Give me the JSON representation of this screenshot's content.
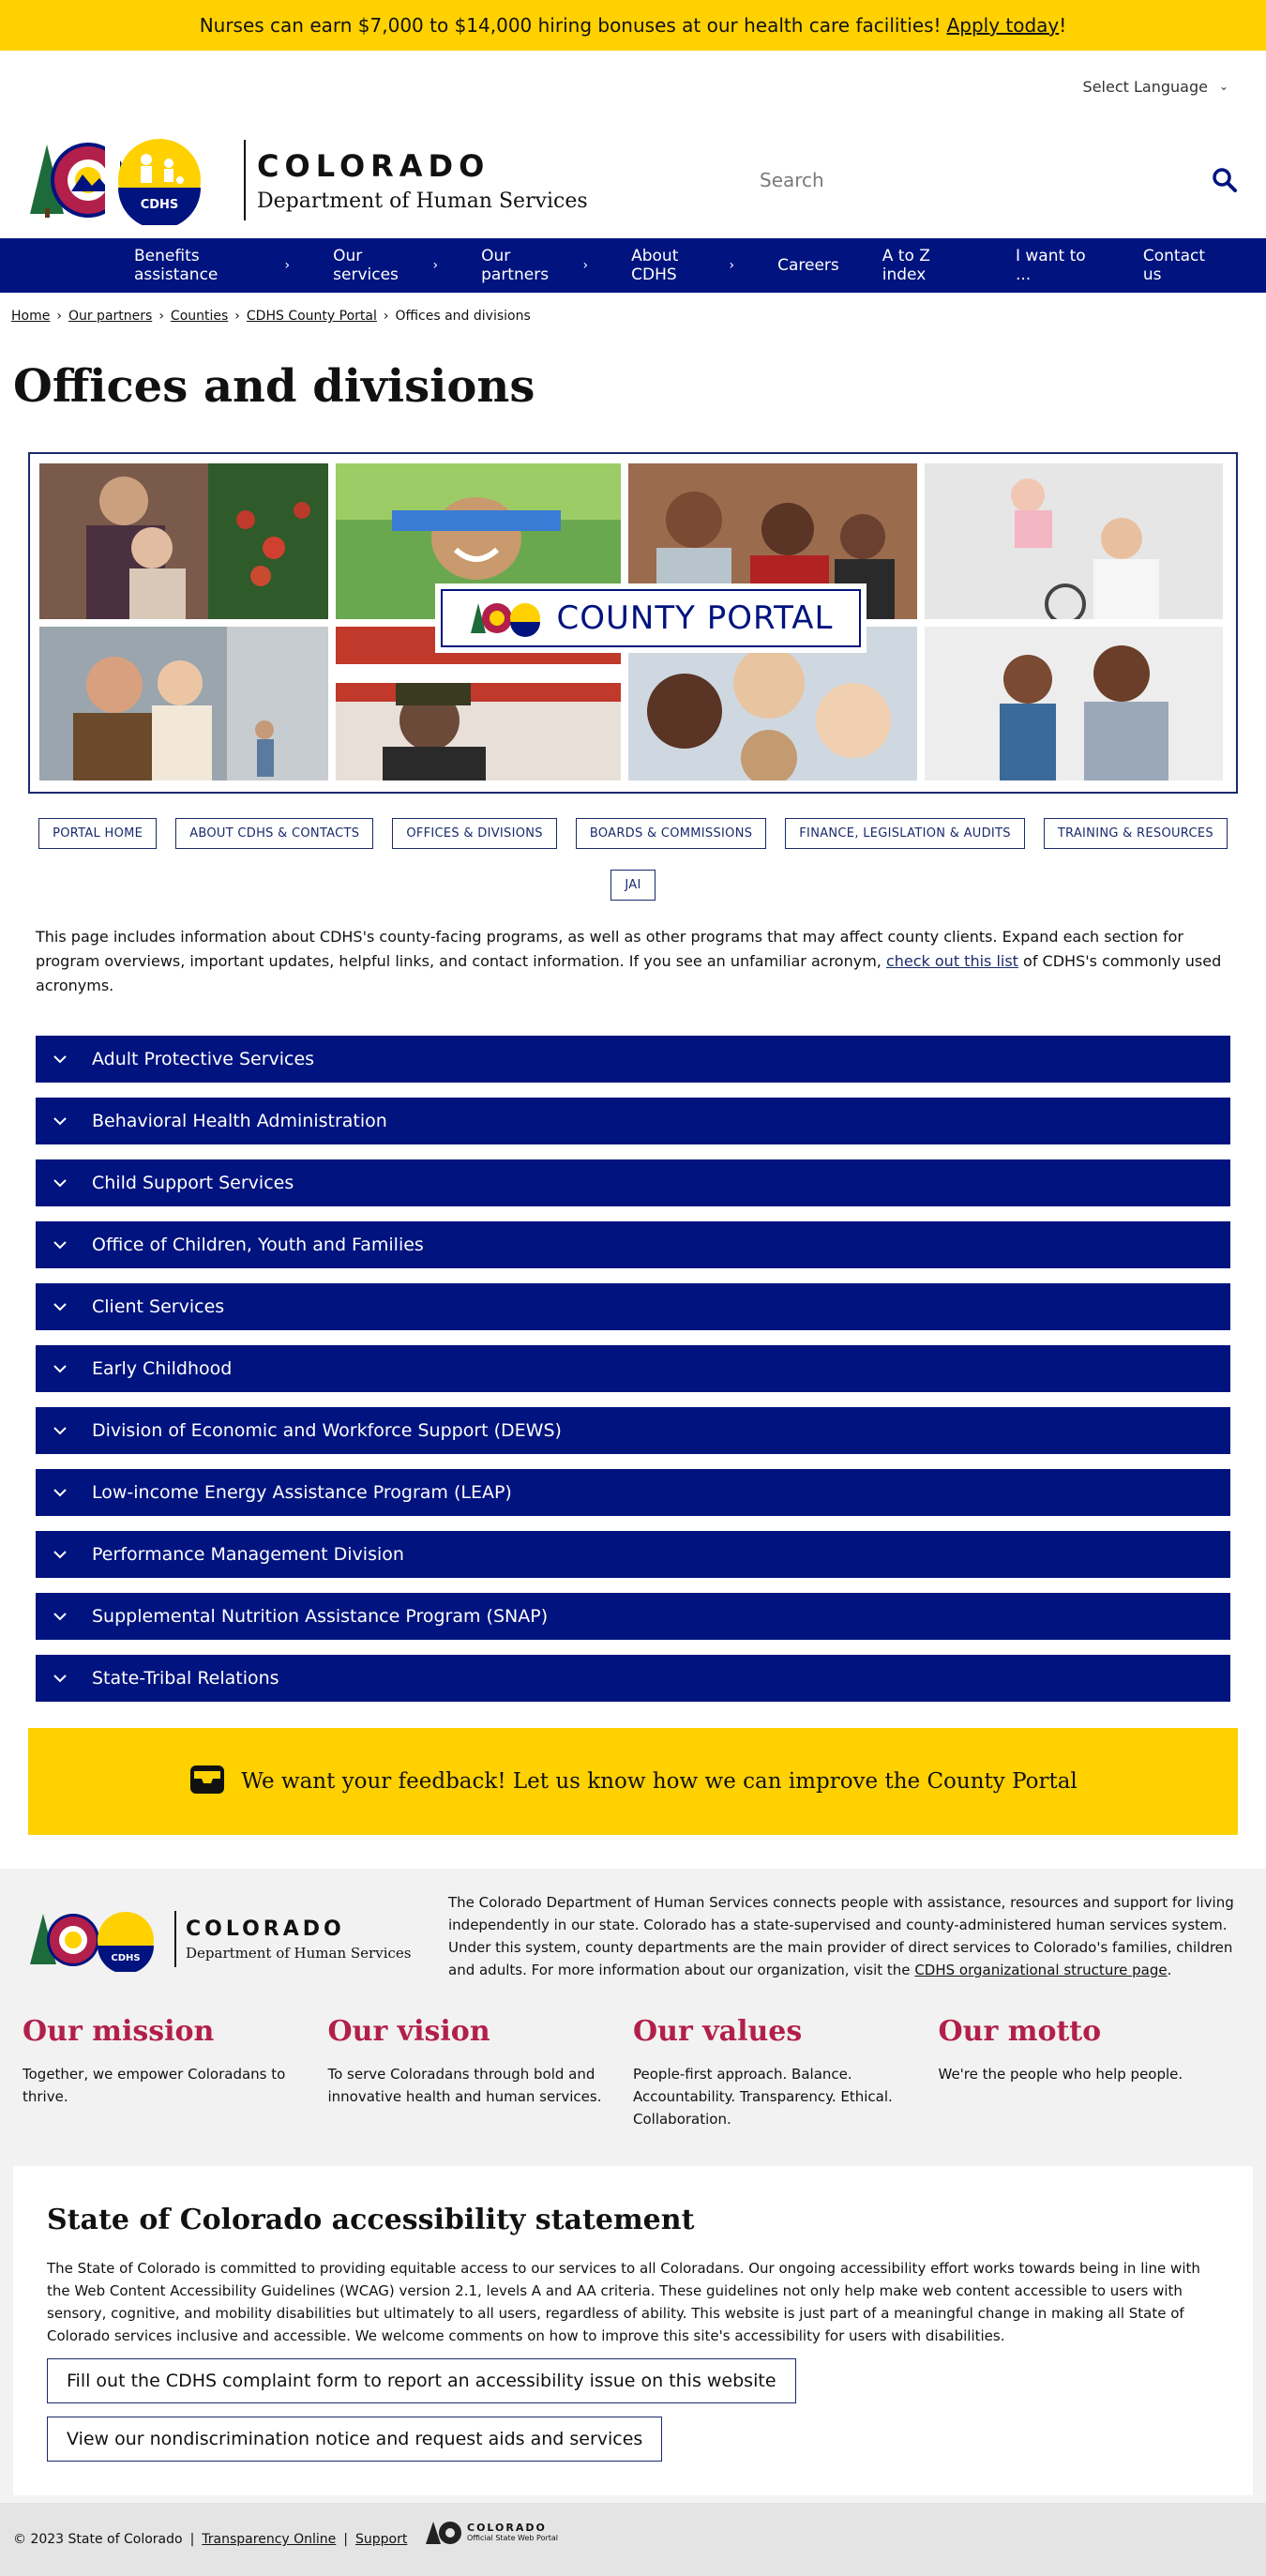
{
  "banner": {
    "text": "Nurses can earn $7,000 to $14,000 hiring bonuses at our health care facilities!",
    "link": "Apply today",
    "suffix": "!"
  },
  "language": {
    "label": "Select Language"
  },
  "header": {
    "state": "COLORADO",
    "department": "Department of Human Services",
    "seal_text": "CDHS",
    "search_placeholder": "Search"
  },
  "nav": {
    "items": [
      {
        "label": "Benefits assistance"
      },
      {
        "label": "Our services"
      },
      {
        "label": "Our partners"
      },
      {
        "label": "About CDHS"
      },
      {
        "label": "Careers"
      },
      {
        "label": "A to Z index"
      },
      {
        "label": "I want to ..."
      },
      {
        "label": "Contact us"
      }
    ]
  },
  "breadcrumb": {
    "items": [
      "Home",
      "Our partners",
      "Counties",
      "CDHS County Portal"
    ],
    "current": "Offices and divisions"
  },
  "page": {
    "title": "Offices and divisions"
  },
  "hero": {
    "badge_text": "COUNTY PORTAL"
  },
  "subnav": {
    "items": [
      "PORTAL HOME",
      "ABOUT CDHS & CONTACTS",
      "OFFICES & DIVISIONS",
      "BOARDS & COMMISSIONS",
      "FINANCE, LEGISLATION & AUDITS",
      "TRAINING & RESOURCES",
      "JAI"
    ]
  },
  "intro": {
    "text1": "This page includes information about CDHS's county-facing programs, as well as other programs that may affect county clients. Expand each section for program overviews, important updates, helpful links, and contact information. If you see an unfamiliar acronym,",
    "link": "check out this list",
    "text2": "of CDHS's commonly used acronyms."
  },
  "accordions": [
    "Adult Protective Services",
    "Behavioral Health Administration",
    "Child Support Services",
    "Office of Children, Youth and Families",
    "Client Services",
    "Early Childhood",
    "Division of Economic and Workforce Support (DEWS)",
    "Low-income Energy Assistance Program (LEAP)",
    "Performance Management Division",
    "Supplemental Nutrition Assistance Program (SNAP)",
    "State-Tribal Relations"
  ],
  "feedback": {
    "text": "We want your feedback! Let us know how we can improve the County Portal"
  },
  "footer": {
    "state": "COLORADO",
    "department": "Department of Human Services",
    "seal_text": "CDHS",
    "description": "The Colorado Department of Human Services connects people with assistance, resources and support for living independently in our state. Colorado has a state-supervised and county-administered human services system. Under this system, county departments are the main provider of direct services to Colorado's families, children and adults. For more information about our organization, visit the",
    "desc_link": "CDHS organizational structure page",
    "desc_end": ".",
    "values": [
      {
        "title": "Our mission",
        "text": "Together, we empower Coloradans to thrive."
      },
      {
        "title": "Our vision",
        "text": "To serve Coloradans through bold and innovative health and human services."
      },
      {
        "title": "Our values",
        "text": "People-first approach. Balance. Accountability. Transparency. Ethical. Collaboration."
      },
      {
        "title": "Our motto",
        "text": "We're the people who help people."
      }
    ],
    "accessibility": {
      "title": "State of Colorado accessibility statement",
      "text": "The State of Colorado is committed to providing equitable access to our services to all Coloradans. Our ongoing accessibility effort works towards being in line with the Web Content Accessibility Guidelines (WCAG) version 2.1, levels A and AA criteria. These guidelines not only help make web content accessible to users with sensory, cognitive, and mobility disabilities but ultimately to all users, regardless of ability. This website is just part of a meaningful change in making all State of Colorado services inclusive and accessible. We welcome comments on how to improve this site's accessibility for users with disabilities.",
      "button1": "Fill out the CDHS complaint form to report an accessibility issue on this website",
      "button2": "View our nondiscrimination notice and request aids and services"
    },
    "bottom": {
      "copyright": "© 2023 State of Colorado",
      "link1": "Transparency Online",
      "link2": "Support",
      "mark_title": "COLORADO",
      "mark_sub": "Official State Web Portal"
    }
  },
  "colors": {
    "yellow": "#FFD100",
    "navy": "#00137F",
    "crimson": "#B21F4B"
  }
}
